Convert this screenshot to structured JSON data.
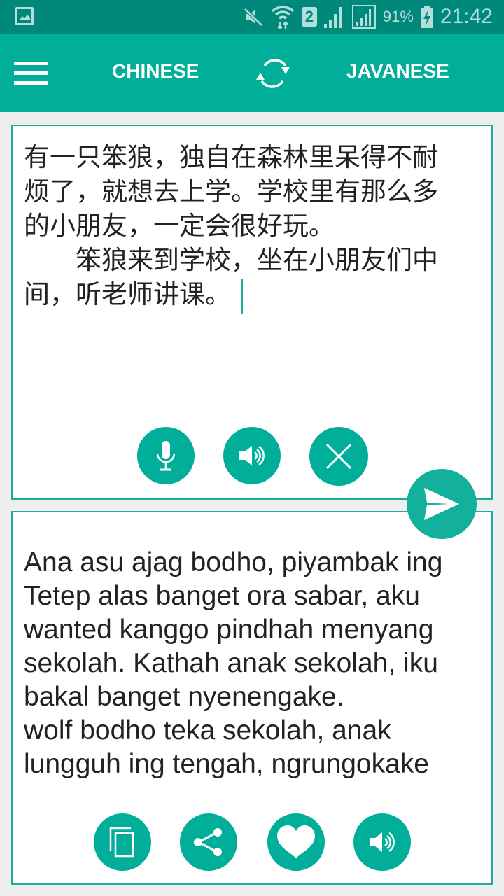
{
  "status_bar": {
    "notification_icon": "gallery-icon",
    "icons": [
      "mute-icon",
      "wifi-icon",
      "sim2-icon",
      "signal-icon",
      "signal-icon-2"
    ],
    "sim_label": "2",
    "battery": "91%",
    "time": "21:42"
  },
  "toolbar": {
    "menu_icon": "hamburger-menu-icon",
    "source_language": "CHINESE",
    "swap_icon": "swap-languages-icon",
    "target_language": "JAVANESE"
  },
  "source_panel": {
    "text": "有一只笨狼，独自在森林里呆得不耐烦了，就想去上学。学校里有那么多的小朋友，一定会很好玩。\n　　笨狼来到学校，坐在小朋友们中间，听老师讲课。",
    "buttons": [
      {
        "name": "microphone",
        "icon": "microphone-icon"
      },
      {
        "name": "speak-source",
        "icon": "speaker-icon"
      },
      {
        "name": "clear",
        "icon": "close-icon"
      }
    ]
  },
  "translate_button": {
    "icon": "send-icon"
  },
  "target_panel": {
    "text": "Ana asu ajag bodho, piyambak ing Tetep alas banget ora sabar, aku wanted kanggo pindhah menyang sekolah. Kathah anak sekolah, iku bakal banget nyenengake.\nwolf bodho teka sekolah, anak lungguh ing tengah, ngrungokake",
    "buttons": [
      {
        "name": "copy",
        "icon": "copy-icon"
      },
      {
        "name": "share",
        "icon": "share-icon"
      },
      {
        "name": "favorite",
        "icon": "heart-icon"
      },
      {
        "name": "speak-target",
        "icon": "speaker-icon"
      }
    ]
  },
  "colors": {
    "status_bar": "#00897B",
    "primary": "#00AE9A",
    "background": "#EEEEEE",
    "text": "#222222"
  }
}
